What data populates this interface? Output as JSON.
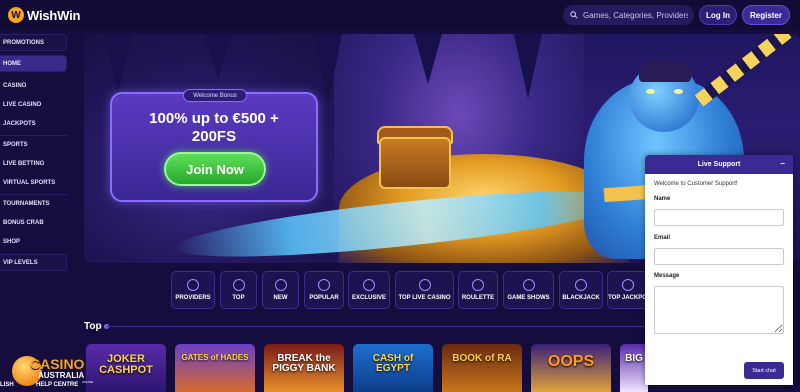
{
  "header": {
    "logo_text": "WishWin",
    "search_placeholder": "Games, Categories, Providers",
    "login_label": "Log In",
    "register_label": "Register"
  },
  "sidebar": {
    "items": [
      {
        "label": "PROMOTIONS",
        "active": false
      },
      {
        "label": "HOME",
        "active": true
      },
      {
        "label": "CASINO",
        "active": false
      },
      {
        "label": "LIVE CASINO",
        "active": false
      },
      {
        "label": "JACKPOTS",
        "active": false
      },
      {
        "label": "SPORTS",
        "active": false
      },
      {
        "label": "LIVE BETTING",
        "active": false
      },
      {
        "label": "VIRTUAL SPORTS",
        "active": false
      },
      {
        "label": "TOURNAMENTS",
        "active": false
      },
      {
        "label": "BONUS CRAB",
        "active": false
      },
      {
        "label": "SHOP",
        "active": false
      },
      {
        "label": "VIP LEVELS",
        "active": false
      }
    ]
  },
  "hero": {
    "tag": "Welcome Bonus",
    "line1": "100% up to €500 +",
    "line2": "200FS",
    "cta": "Join Now"
  },
  "categories": [
    {
      "label": "PROVIDERS",
      "icon": "providers-icon"
    },
    {
      "label": "TOP",
      "icon": "crown-icon"
    },
    {
      "label": "NEW",
      "icon": "lightning-icon"
    },
    {
      "label": "POPULAR",
      "icon": "star-icon"
    },
    {
      "label": "EXCLUSIVE",
      "icon": "diamond-icon"
    },
    {
      "label": "TOP LIVE CASINO",
      "icon": "live-icon"
    },
    {
      "label": "ROULETTE",
      "icon": "roulette-icon"
    },
    {
      "label": "GAME SHOWS",
      "icon": "game-shows-icon"
    },
    {
      "label": "BLACKJACK",
      "icon": "cards-icon"
    },
    {
      "label": "TOP JACKPO",
      "icon": "jackpot-icon"
    }
  ],
  "top_section": {
    "title": "Top"
  },
  "games": [
    {
      "title": "JOKER\nCASHPOT",
      "color_top": "#5a2aa8",
      "color_bottom": "#2b1670"
    },
    {
      "title": "GATES of HADES",
      "color_top": "#6a3fc4",
      "color_bottom": "#d86a2e"
    },
    {
      "title": "BREAK the\nPIGGY BANK",
      "color_top": "#7a1a1a",
      "color_bottom": "#e7902a"
    },
    {
      "title": "CASH of\nEGYPT",
      "color_top": "#1e6fd0",
      "color_bottom": "#0c3d8a"
    },
    {
      "title": "BOOK of RA",
      "color_top": "#6b2a12",
      "color_bottom": "#c8761a"
    },
    {
      "title": "OOPS",
      "color_top": "#3a1f7a",
      "color_bottom": "#e0a33a"
    },
    {
      "title": "BIG",
      "color_top": "#5a2aa8",
      "color_bottom": "#f2e3ff"
    }
  ],
  "watermark": {
    "brand": "CASINO",
    "country": "AUSTRALIA",
    "small": "ONLINE",
    "help_centre": "HELP CENTRE",
    "cut_text": "LISH"
  },
  "support": {
    "title": "Live Support",
    "minimize": "–",
    "welcome": "Welcome to Customer Support!",
    "name_label": "Name",
    "email_label": "Email",
    "message_label": "Message",
    "start_label": "Start chat"
  }
}
